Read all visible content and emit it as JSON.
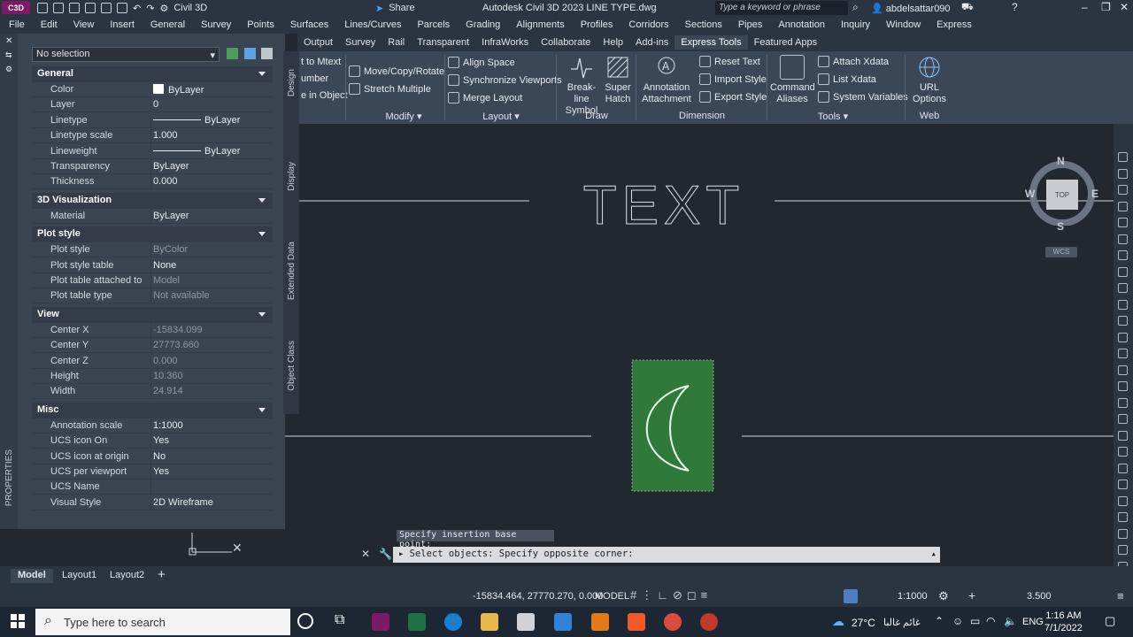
{
  "title_bar": {
    "workspace": "Civil 3D",
    "share_label": "Share",
    "window_title": "Autodesk Civil 3D 2023   LINE TYPE.dwg",
    "search_placeholder": "Type a keyword or phrase",
    "user": "abdelsattar090"
  },
  "menu": [
    "File",
    "Edit",
    "View",
    "Insert",
    "General",
    "Survey",
    "Points",
    "Surfaces",
    "Lines/Curves",
    "Parcels",
    "Grading",
    "Alignments",
    "Profiles",
    "Corridors",
    "Sections",
    "Pipes",
    "Annotation",
    "Inquiry",
    "Window",
    "Express"
  ],
  "ribbon_tabs": [
    "Output",
    "Survey",
    "Rail",
    "Transparent",
    "InfraWorks",
    "Collaborate",
    "Help",
    "Add-ins",
    "Express Tools",
    "Featured Apps"
  ],
  "ribbon_active_tab": "Express Tools",
  "ribbon": {
    "text_panel": [
      "t to Mtext",
      "umber",
      "e in Object"
    ],
    "modify": {
      "buttons": [
        "Move/Copy/Rotate",
        "Stretch Multiple"
      ],
      "label": "Modify"
    },
    "layout": {
      "buttons": [
        "Align Space",
        "Synchronize Viewports",
        "Merge Layout"
      ],
      "label": "Layout"
    },
    "draw": {
      "buttons": [
        "Break-line Symbol",
        "Super Hatch"
      ],
      "label": "Draw"
    },
    "dimension": {
      "big": "Annotation Attachment",
      "buttons": [
        "Reset Text",
        "Import Style",
        "Export Style"
      ],
      "label": "Dimension"
    },
    "tools": {
      "big": "Command Aliases",
      "buttons": [
        "Attach Xdata",
        "List Xdata",
        "System Variables"
      ],
      "label": "Tools"
    },
    "web": {
      "big": "URL Options",
      "label": "Web"
    }
  },
  "properties": {
    "selection": "No selection",
    "side_label": "PROPERTIES",
    "side_tabs": [
      "Design",
      "Display",
      "Extended Data",
      "Object Class"
    ],
    "groups": [
      {
        "name": "General",
        "rows": [
          {
            "key": "Color",
            "value": "ByLayer"
          },
          {
            "key": "Layer",
            "value": "0"
          },
          {
            "key": "Linetype",
            "value": "ByLayer"
          },
          {
            "key": "Linetype scale",
            "value": "1.000"
          },
          {
            "key": "Lineweight",
            "value": "ByLayer"
          },
          {
            "key": "Transparency",
            "value": "ByLayer"
          },
          {
            "key": "Thickness",
            "value": "0.000"
          }
        ]
      },
      {
        "name": "3D Visualization",
        "rows": [
          {
            "key": "Material",
            "value": "ByLayer"
          }
        ]
      },
      {
        "name": "Plot style",
        "rows": [
          {
            "key": "Plot style",
            "value": "ByColor",
            "dim": true
          },
          {
            "key": "Plot style table",
            "value": "None"
          },
          {
            "key": "Plot table attached to",
            "value": "Model",
            "dim": true
          },
          {
            "key": "Plot table type",
            "value": "Not available",
            "dim": true
          }
        ]
      },
      {
        "name": "View",
        "rows": [
          {
            "key": "Center X",
            "value": "-15834.099",
            "dim": true
          },
          {
            "key": "Center Y",
            "value": "27773.660",
            "dim": true
          },
          {
            "key": "Center Z",
            "value": "0.000",
            "dim": true
          },
          {
            "key": "Height",
            "value": "10.360",
            "dim": true
          },
          {
            "key": "Width",
            "value": "24.914",
            "dim": true
          }
        ]
      },
      {
        "name": "Misc",
        "rows": [
          {
            "key": "Annotation scale",
            "value": "1:1000"
          },
          {
            "key": "UCS icon On",
            "value": "Yes"
          },
          {
            "key": "UCS icon at origin",
            "value": "No"
          },
          {
            "key": "UCS per viewport",
            "value": "Yes"
          },
          {
            "key": "UCS Name",
            "value": ""
          },
          {
            "key": "Visual Style",
            "value": "2D Wireframe"
          }
        ]
      }
    ]
  },
  "drawing": {
    "text": "TEXT",
    "viewcube": {
      "top": "TOP",
      "n": "N",
      "s": "S",
      "e": "E",
      "w": "W",
      "wcs": "WCS"
    },
    "hatch_color": "#2f7a3a"
  },
  "command": {
    "history": "Specify insertion base point:",
    "current": "Select objects: Specify opposite corner:"
  },
  "layout_tabs": [
    "Model",
    "Layout1",
    "Layout2"
  ],
  "status": {
    "coords": "-15834.464, 27770.270, 0.000",
    "space": "MODEL",
    "scale": "1:1000",
    "value": "3.500"
  },
  "taskbar": {
    "search": "Type here to search",
    "weather": "27°C",
    "weather_text": "غائم غالبا",
    "lang": "ENG",
    "time": "1:16 AM",
    "date": "7/1/2022"
  }
}
